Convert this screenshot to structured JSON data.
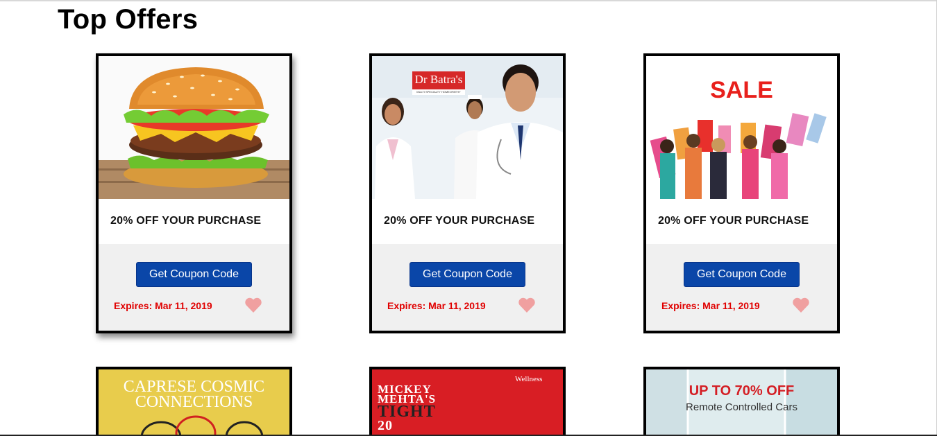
{
  "page": {
    "title": "Top Offers"
  },
  "offers": [
    {
      "title": "20% OFF YOUR PURCHASE",
      "button": "Get Coupon Code",
      "expires": "Expires: Mar 11, 2019"
    },
    {
      "title": "20% OFF YOUR PURCHASE",
      "button": "Get Coupon Code",
      "expires": "Expires: Mar 11, 2019",
      "brand": "Dr Batra's",
      "brand_sub": "MULTI SPECIALTY HOMEOPATHY"
    },
    {
      "title": "20% OFF YOUR PURCHASE",
      "button": "Get Coupon Code",
      "expires": "Expires: Mar 11, 2019",
      "banner": "SALE"
    }
  ],
  "row2": [
    {
      "banner_line1": "CAPRESE COSMIC",
      "banner_line2": "CONNECTIONS"
    },
    {
      "banner_line1": "MICKEY",
      "banner_line2": "MEHTA'S",
      "banner_line3": "TIGHT",
      "banner_line4": "20",
      "corner": "Wellness"
    },
    {
      "banner_line1": "UP TO 70% OFF",
      "banner_line2": "Remote Controlled Cars"
    }
  ],
  "colors": {
    "button": "#0a46a8",
    "expires": "#e00000",
    "heart": "#f0a0a0"
  },
  "icons": {
    "favorite": "heart-icon"
  }
}
